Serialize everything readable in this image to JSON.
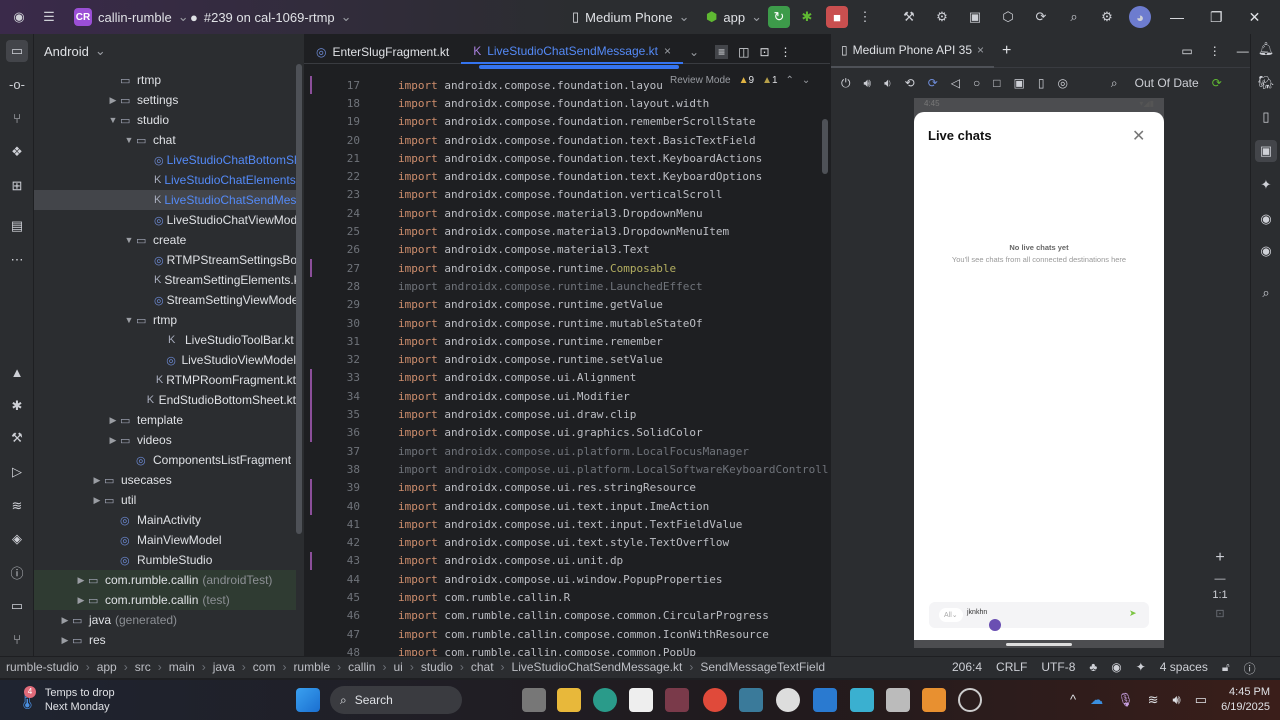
{
  "titlebar": {
    "project_badge": "CR",
    "project": "callin-rumble",
    "branch": "#239 on cal-1069-rtmp",
    "device": "Medium Phone",
    "run_config": "app"
  },
  "project_panel": {
    "view": "Android",
    "items": [
      {
        "label": "rtmp",
        "type": "folder",
        "indent": 5,
        "arrow": ""
      },
      {
        "label": "settings",
        "type": "folder",
        "indent": 5,
        "arrow": "right"
      },
      {
        "label": "studio",
        "type": "folder",
        "indent": 5,
        "arrow": "down"
      },
      {
        "label": "chat",
        "type": "folder",
        "indent": 6,
        "arrow": "down"
      },
      {
        "label": "LiveStudioChatBottomSheet",
        "type": "compose",
        "indent": 8,
        "arrow": "",
        "color": "#548af7"
      },
      {
        "label": "LiveStudioChatElements.kt",
        "type": "kotlin",
        "indent": 8,
        "arrow": "",
        "color": "#548af7"
      },
      {
        "label": "LiveStudioChatSendMessage",
        "type": "kotlin",
        "indent": 8,
        "arrow": "",
        "color": "#548af7",
        "selected": true
      },
      {
        "label": "LiveStudioChatViewModel",
        "type": "class",
        "indent": 8,
        "arrow": ""
      },
      {
        "label": "create",
        "type": "folder",
        "indent": 6,
        "arrow": "down"
      },
      {
        "label": "RTMPStreamSettingsBottomSheet",
        "type": "compose",
        "indent": 8,
        "arrow": ""
      },
      {
        "label": "StreamSettingElements.kt",
        "type": "kotlin",
        "indent": 8,
        "arrow": ""
      },
      {
        "label": "StreamSettingViewModel",
        "type": "class",
        "indent": 8,
        "arrow": ""
      },
      {
        "label": "rtmp",
        "type": "folder",
        "indent": 6,
        "arrow": "down"
      },
      {
        "label": "LiveStudioToolBar.kt",
        "type": "kotlin",
        "indent": 8,
        "arrow": ""
      },
      {
        "label": "LiveStudioViewModel",
        "type": "class",
        "indent": 8,
        "arrow": ""
      },
      {
        "label": "RTMPRoomFragment.kt",
        "type": "kotlin",
        "indent": 8,
        "arrow": ""
      },
      {
        "label": "EndStudioBottomSheet.kt",
        "type": "kotlin",
        "indent": 7,
        "arrow": ""
      },
      {
        "label": "template",
        "type": "folder",
        "indent": 5,
        "arrow": "right"
      },
      {
        "label": "videos",
        "type": "folder",
        "indent": 5,
        "arrow": "right"
      },
      {
        "label": "ComponentsListFragment",
        "type": "class",
        "indent": 6,
        "arrow": ""
      },
      {
        "label": "usecases",
        "type": "folder",
        "indent": 4,
        "arrow": "right"
      },
      {
        "label": "util",
        "type": "folder",
        "indent": 4,
        "arrow": "right"
      },
      {
        "label": "MainActivity",
        "type": "class",
        "indent": 5,
        "arrow": ""
      },
      {
        "label": "MainViewModel",
        "type": "class",
        "indent": 5,
        "arrow": ""
      },
      {
        "label": "RumbleStudio",
        "type": "class",
        "indent": 5,
        "arrow": ""
      },
      {
        "label": "com.rumble.callin",
        "suffix": "(androidTest)",
        "type": "package",
        "indent": 3,
        "arrow": "right",
        "test": true
      },
      {
        "label": "com.rumble.callin",
        "suffix": "(test)",
        "type": "package",
        "indent": 3,
        "arrow": "right",
        "test": true
      },
      {
        "label": "java",
        "suffix": "(generated)",
        "type": "folder",
        "indent": 2,
        "arrow": "right"
      },
      {
        "label": "res",
        "type": "folder",
        "indent": 2,
        "arrow": "right"
      }
    ]
  },
  "editor": {
    "tabs": [
      {
        "label": "EnterSlugFragment.kt",
        "active": false
      },
      {
        "label": "LiveStudioChatSendMessage.kt",
        "active": true
      }
    ],
    "review_mode": "Review Mode",
    "warnings": "9",
    "weak_warnings": "1",
    "lines": [
      {
        "n": "17",
        "pkg": "androidx.compose.foundation.layou"
      },
      {
        "n": "18",
        "pkg": "androidx.compose.foundation.layout.width"
      },
      {
        "n": "19",
        "pkg": "androidx.compose.foundation.rememberScrollState"
      },
      {
        "n": "20",
        "pkg": "androidx.compose.foundation.text.BasicTextField"
      },
      {
        "n": "21",
        "pkg": "androidx.compose.foundation.text.KeyboardActions"
      },
      {
        "n": "22",
        "pkg": "androidx.compose.foundation.text.KeyboardOptions"
      },
      {
        "n": "23",
        "pkg": "androidx.compose.foundation.verticalScroll"
      },
      {
        "n": "24",
        "pkg": "androidx.compose.material3.DropdownMenu"
      },
      {
        "n": "25",
        "pkg": "androidx.compose.material3.DropdownMenuItem"
      },
      {
        "n": "26",
        "pkg": "androidx.compose.material3.Text"
      },
      {
        "n": "27",
        "pkg": "androidx.compose.runtime.",
        "hl": "Composable"
      },
      {
        "n": "28",
        "pkg": "androidx.compose.runtime.LaunchedEffect",
        "fade": true
      },
      {
        "n": "29",
        "pkg": "androidx.compose.runtime.getValue"
      },
      {
        "n": "30",
        "pkg": "androidx.compose.runtime.mutableStateOf"
      },
      {
        "n": "31",
        "pkg": "androidx.compose.runtime.remember"
      },
      {
        "n": "32",
        "pkg": "androidx.compose.runtime.setValue"
      },
      {
        "n": "33",
        "pkg": "androidx.compose.ui.Alignment"
      },
      {
        "n": "34",
        "pkg": "androidx.compose.ui.Modifier"
      },
      {
        "n": "35",
        "pkg": "androidx.compose.ui.draw.clip"
      },
      {
        "n": "36",
        "pkg": "androidx.compose.ui.graphics.SolidColor"
      },
      {
        "n": "37",
        "pkg": "androidx.compose.ui.platform.LocalFocusManager",
        "fade": true
      },
      {
        "n": "38",
        "pkg": "androidx.compose.ui.platform.LocalSoftwareKeyboardControll",
        "fade": true
      },
      {
        "n": "39",
        "pkg": "androidx.compose.ui.res.stringResource"
      },
      {
        "n": "40",
        "pkg": "androidx.compose.ui.text.input.ImeAction"
      },
      {
        "n": "41",
        "pkg": "androidx.compose.ui.text.input.TextFieldValue"
      },
      {
        "n": "42",
        "pkg": "androidx.compose.ui.text.style.TextOverflow"
      },
      {
        "n": "43",
        "pkg": "androidx.compose.ui.unit.dp"
      },
      {
        "n": "44",
        "pkg": "androidx.compose.ui.window.PopupProperties"
      },
      {
        "n": "45",
        "pkg": "com.rumble.callin.R"
      },
      {
        "n": "46",
        "pkg": "com.rumble.callin.compose.common.CircularProgress"
      },
      {
        "n": "47",
        "pkg": "com.rumble.callin.compose.common.IconWithResource"
      },
      {
        "n": "48",
        "pkg": "com.rumble.callin.compose.common.PopUp"
      }
    ],
    "keyword": "import"
  },
  "emulator": {
    "tab": "Medium Phone API 35",
    "out_of_date": "Out Of Date",
    "zoom_label": "1:1",
    "phone": {
      "clock": "4:45",
      "sheet_title": "Live chats",
      "empty_title": "No live chats yet",
      "empty_sub": "You'll see chats from all connected destinations here",
      "filter": "All",
      "input_value": "jknkhn"
    }
  },
  "statusbar": {
    "breadcrumb": [
      "rumble-studio",
      "app",
      "src",
      "main",
      "java",
      "com",
      "rumble",
      "callin",
      "ui",
      "studio",
      "chat",
      "LiveStudioChatSendMessage.kt",
      "SendMessageTextField"
    ],
    "position": "206:4",
    "line_sep": "CRLF",
    "encoding": "UTF-8",
    "indent": "4 spaces"
  },
  "taskbar": {
    "weather_title": "Temps to drop",
    "weather_sub": "Next Monday",
    "weather_badge": "4",
    "search": "Search",
    "time": "4:45 PM",
    "date": "6/19/2025"
  }
}
